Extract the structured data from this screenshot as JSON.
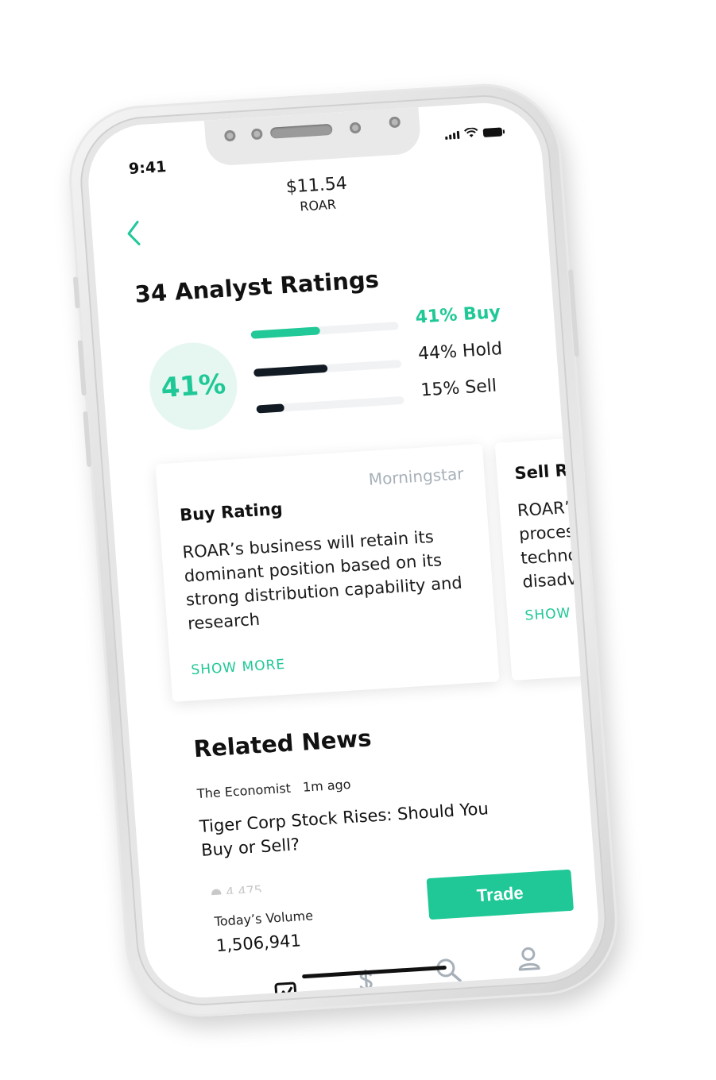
{
  "status": {
    "time": "9:41"
  },
  "header": {
    "price": "$11.54",
    "ticker": "ROAR",
    "back_icon": "chevron-left-icon"
  },
  "ratings": {
    "title": "34 Analyst Ratings",
    "circle_value": "41%",
    "bars": [
      {
        "label": "41% Buy",
        "fraction": 0.47,
        "color": "#20c997"
      },
      {
        "label": "44% Hold",
        "fraction": 0.5,
        "color": "#121a23"
      },
      {
        "label": "15% Sell",
        "fraction": 0.19,
        "color": "#121a23"
      }
    ]
  },
  "cards": [
    {
      "title": "Buy Rating",
      "source": "Morningstar",
      "body": "ROAR’s business will retain its dominant position based on its strong distribution capability and research",
      "show_more": "SHOW MORE"
    },
    {
      "title": "Sell Ra",
      "body": "ROAR’s process technol disadva",
      "show_more": "SHOW MO"
    }
  ],
  "news": {
    "title": "Related News",
    "source": "The Economist",
    "time": "1m ago",
    "headline": "Tiger Corp Stock Rises: Should You Buy or Sell?",
    "count": "4,475"
  },
  "volume": {
    "label": "Today’s Volume",
    "value": "1,506,941"
  },
  "trade": {
    "label": "Trade"
  },
  "tabs": [
    {
      "name": "tab-portfolio",
      "icon": "chart-icon",
      "active": true
    },
    {
      "name": "tab-funds",
      "icon": "dollar-icon",
      "active": false
    },
    {
      "name": "tab-search",
      "icon": "search-icon",
      "active": false
    },
    {
      "name": "tab-account",
      "icon": "user-icon",
      "active": false
    }
  ],
  "colors": {
    "accent": "#1fc896",
    "dark": "#121a23",
    "muted": "#a7b0b8"
  }
}
